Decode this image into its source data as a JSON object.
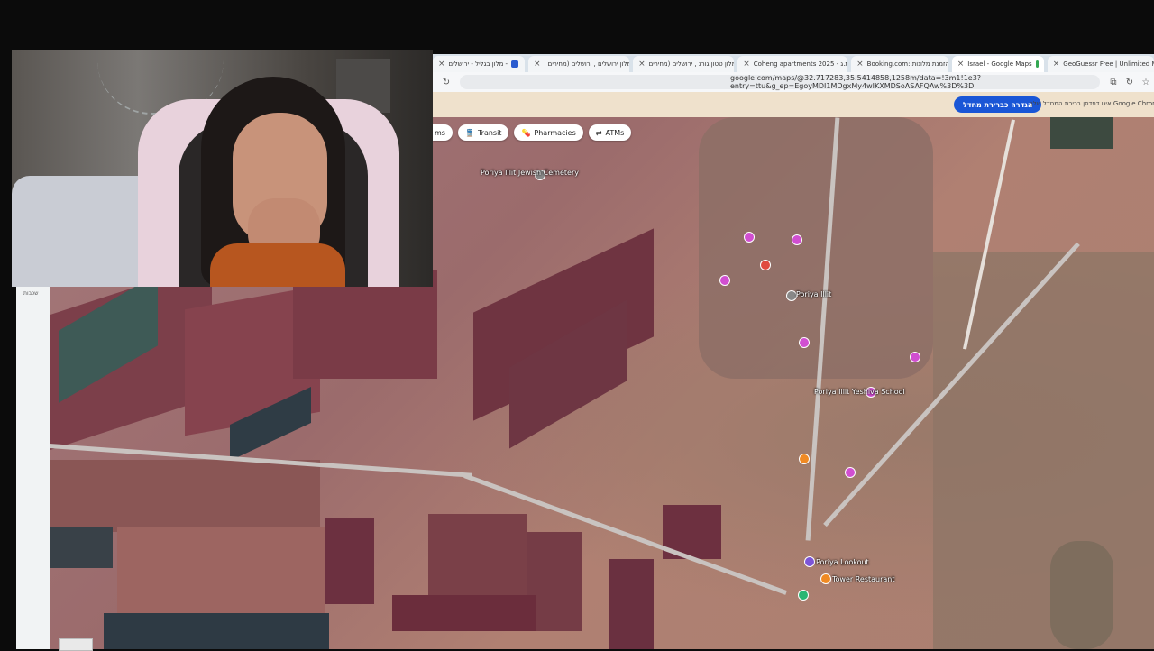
{
  "browser": {
    "tabs": [
      {
        "label": "מלון בגליל - ירושלים -",
        "favicon": "booking-icon",
        "active": false
      },
      {
        "label": "מלון ירושלים , ירושלים (מחירים ו",
        "favicon": "booking-icon",
        "active": false
      },
      {
        "label": "מלון טטון גורג , ירושלים (מחירים",
        "favicon": "booking-icon",
        "active": false
      },
      {
        "label": "Coheng apartments 2025 - ת.ג.",
        "favicon": "booking-icon",
        "active": false
      },
      {
        "label": "Booking.com: הזמנת מלונות",
        "favicon": "booking-icon",
        "active": false
      },
      {
        "label": "Israel - Google Maps",
        "favicon": "maps-icon",
        "active": true
      },
      {
        "label": "GeoGuessr Free | Unlimited M",
        "favicon": "geoguessr-icon",
        "active": false
      }
    ],
    "url": "google.com/maps/@32.717283,35.5414858,1258m/data=!3m1!1e3?entry=ttu&g_ep=EgoyMDI1MDgxMy4wIKXMDSoASAFQAw%3D%3D",
    "infobar": {
      "button_label": "הגדרה כברירת מחדל",
      "message": "אינו דפדפן ברירת המחדל שלך Google Chrome"
    }
  },
  "map": {
    "chips": [
      {
        "label": "ms",
        "icon": "none"
      },
      {
        "label": "Transit",
        "icon": "transit-icon"
      },
      {
        "label": "Pharmacies",
        "icon": "pharmacy-icon"
      },
      {
        "label": "ATMs",
        "icon": "atm-icon"
      }
    ],
    "labels": {
      "cemetery": "Poriya Illit Jewish Cemetery",
      "settlement": "Poriya Illit",
      "school": "Poriya Illit Yeshiva School",
      "lookout": "Poriya Lookout",
      "restaurant": "Tower Restaurant"
    },
    "left_strip_label": "שכבות",
    "accent_color": "#1a56d6"
  }
}
